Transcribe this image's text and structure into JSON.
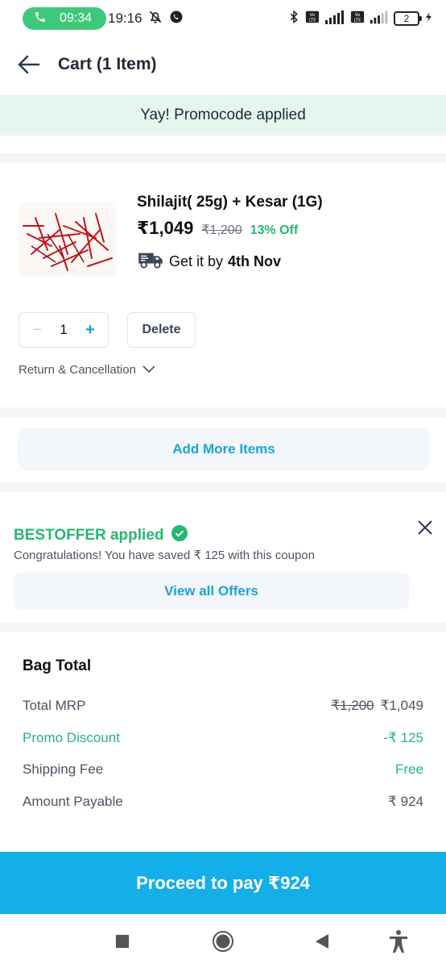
{
  "status_bar": {
    "call_time": "09:34",
    "clock": "19:16",
    "battery": "2",
    "icons": [
      "phone-icon",
      "mute-icon",
      "whatsapp-icon",
      "bluetooth-icon",
      "volte-icon",
      "signal-icon",
      "battery-icon",
      "charging-icon"
    ]
  },
  "header": {
    "title": "Cart (1 Item)"
  },
  "promo_banner": {
    "text": "Yay! Promocode applied"
  },
  "product": {
    "name": "Shilajit( 25g) + Kesar (1G)",
    "price": "₹1,049",
    "mrp": "₹1,200",
    "discount": "13% Off",
    "delivery_prefix": "Get it by",
    "delivery_date": "4th Nov",
    "quantity": "1",
    "qty_minus": "−",
    "qty_plus": "+",
    "delete_label": "Delete",
    "return_label": "Return & Cancellation"
  },
  "add_more": {
    "label": "Add More Items"
  },
  "coupon": {
    "title": "BESTOFFER applied",
    "subtitle": "Congratulations! You have saved ₹ 125 with this coupon",
    "view_offers": "View all Offers"
  },
  "bag_total": {
    "title": "Bag Total",
    "rows": [
      {
        "label": "Total MRP",
        "strike": "₹1,200",
        "value": "₹1,049"
      },
      {
        "label": "Promo Discount",
        "value": "-₹ 125"
      },
      {
        "label": "Shipping Fee",
        "value": "Free"
      },
      {
        "label": "Amount Payable",
        "value": "₹ 924"
      }
    ]
  },
  "proceed": {
    "label": "Proceed to pay ₹924"
  },
  "colors": {
    "accent": "#14aee8",
    "success": "#29b574",
    "promo_bg": "#e6f6ef",
    "call_pill": "#3ec97a"
  }
}
